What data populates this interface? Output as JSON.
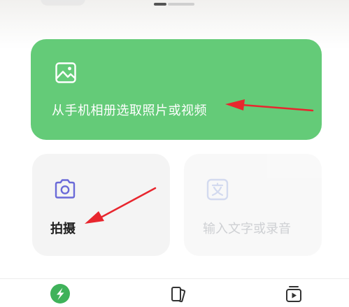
{
  "sheet": {
    "handle": "drag-handle"
  },
  "options": {
    "album": {
      "label": "从手机相册选取照片或视频",
      "icon": "image-icon",
      "color": "#64cb78"
    },
    "camera": {
      "label": "拍摄",
      "icon": "camera-icon",
      "color": "#f4f4f4"
    },
    "text": {
      "label": "输入文字或录音",
      "icon": "text-translate-icon",
      "disabled": true
    }
  },
  "annotations": {
    "arrow_color": "#e8262e"
  },
  "tabbar": {
    "tabs": [
      {
        "icon": "app-logo-icon",
        "active": true
      },
      {
        "icon": "cards-icon",
        "active": false
      },
      {
        "icon": "video-play-icon",
        "active": false
      }
    ]
  }
}
